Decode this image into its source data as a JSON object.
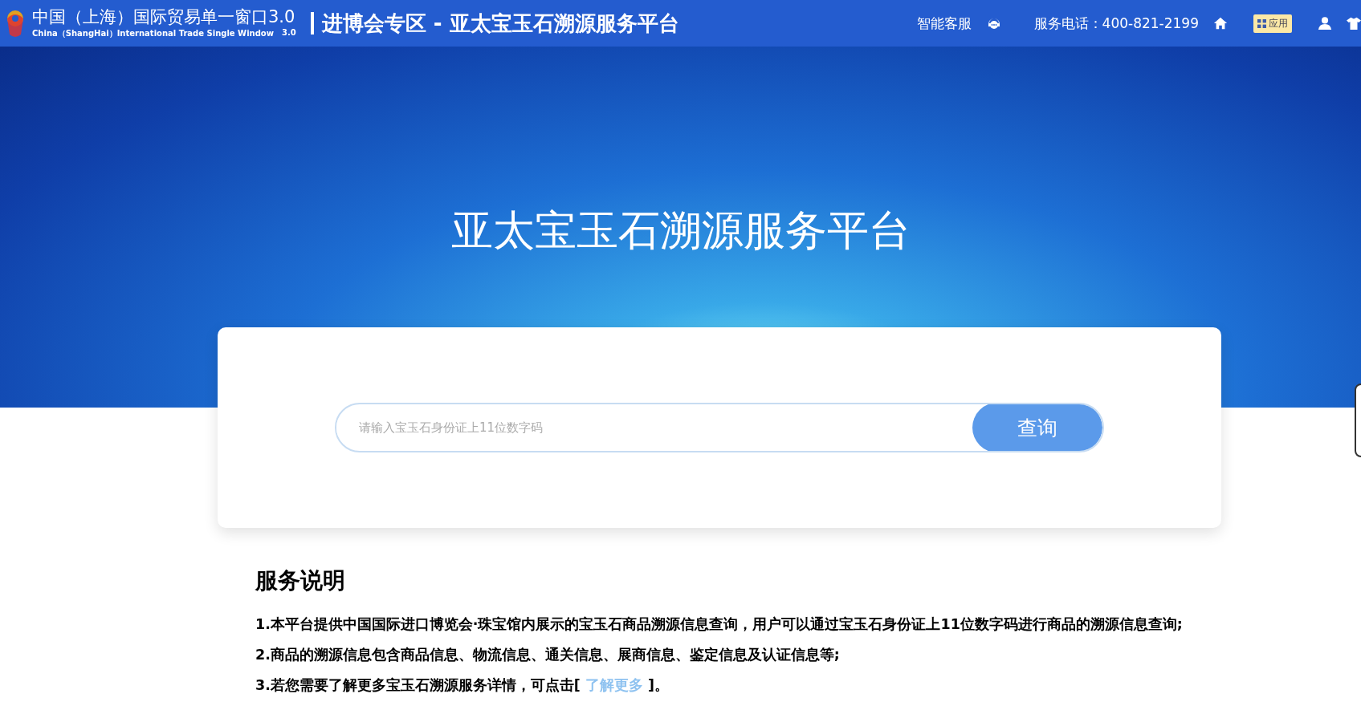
{
  "header": {
    "logo_title": "中国（上海）国际贸易单一窗口3.0",
    "logo_subtitle": "China（ShangHai）International  Trade Single  Window",
    "logo_version": "3.0",
    "section_title": "进博会专区 - 亚太宝玉石溯源服务平台",
    "service_label": "智能客服",
    "phone": "服务电话：400-821-2199",
    "apps_label": "应用"
  },
  "hero": {
    "title": "亚太宝玉石溯源服务平台"
  },
  "search": {
    "placeholder": "请输入宝玉石身份证上11位数字码",
    "button": "查询"
  },
  "description": {
    "heading": "服务说明",
    "lines": [
      {
        "text": "1.本平台提供中国国际进口博览会·珠宝馆内展示的宝玉石商品溯源信息查询，用户可以通过宝玉石身份证上11位数字码进行商品的溯源信息查询;"
      },
      {
        "text": "2.商品的溯源信息包含商品信息、物流信息、通关信息、展商信息、鉴定信息及认证信息等;"
      },
      {
        "text": "3.若您需要了解更多宝玉石溯源服务详情，可点击[ ",
        "link": "了解更多",
        "after": " ]。"
      }
    ]
  }
}
